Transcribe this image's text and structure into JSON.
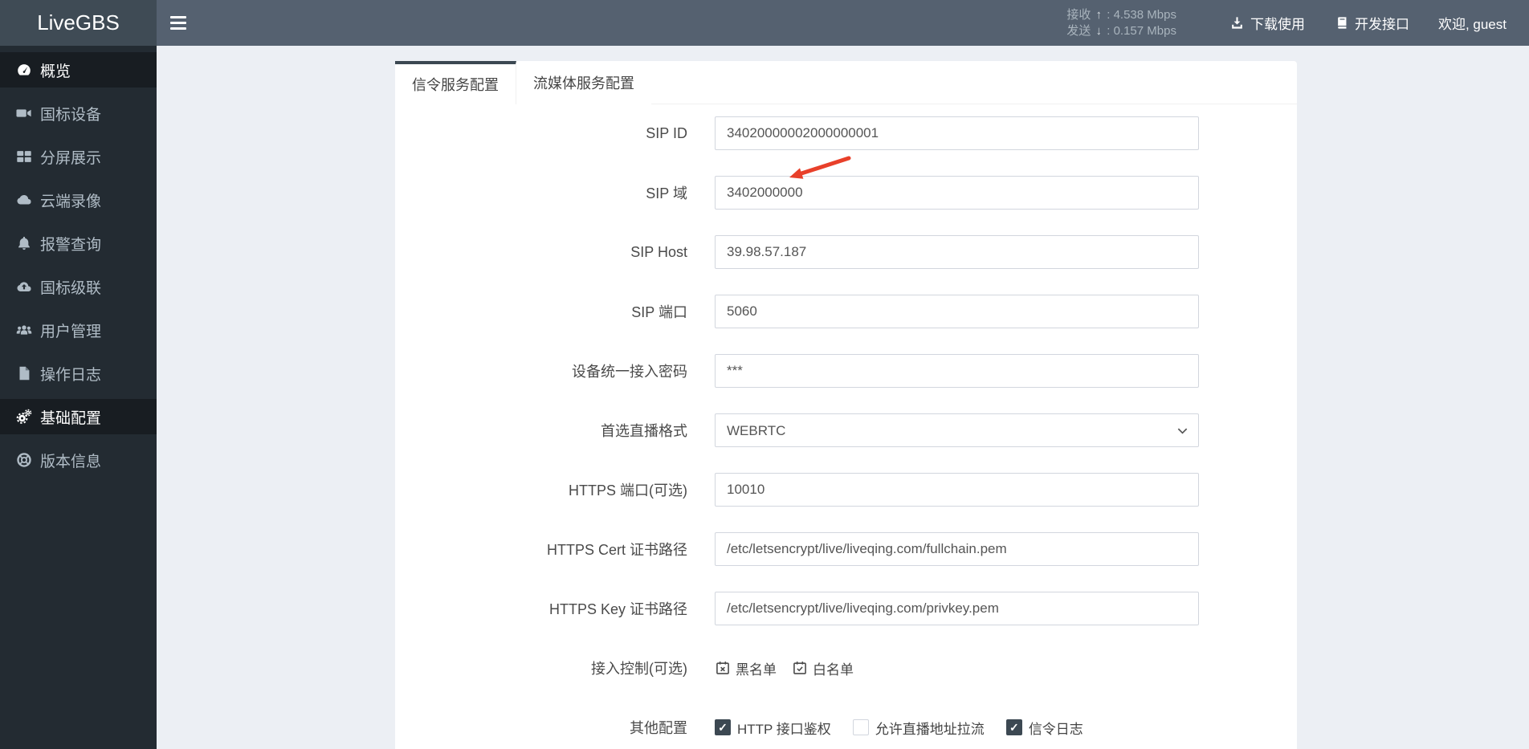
{
  "app": {
    "title": "LiveGBS"
  },
  "header": {
    "separator": ":",
    "stats": {
      "recv_label": "接收",
      "recv_value": "4.538 Mbps",
      "send_label": "发送",
      "send_value": "0.157 Mbps"
    },
    "download_label": "下载使用",
    "api_label": "开发接口",
    "welcome_label": "欢迎, guest"
  },
  "sidebar": {
    "items": [
      {
        "label": "概览",
        "icon": "dashboard-icon",
        "active": true
      },
      {
        "label": "国标设备",
        "icon": "camera-icon",
        "active": false
      },
      {
        "label": "分屏展示",
        "icon": "grid-icon",
        "active": false
      },
      {
        "label": "云端录像",
        "icon": "cloud-icon",
        "active": false
      },
      {
        "label": "报警查询",
        "icon": "bell-icon",
        "active": false
      },
      {
        "label": "国标级联",
        "icon": "cloud-upload-icon",
        "active": false
      },
      {
        "label": "用户管理",
        "icon": "users-icon",
        "active": false
      },
      {
        "label": "操作日志",
        "icon": "file-icon",
        "active": false
      },
      {
        "label": "基础配置",
        "icon": "gears-icon",
        "active": true
      },
      {
        "label": "版本信息",
        "icon": "version-icon",
        "active": false
      }
    ]
  },
  "tabs": [
    {
      "label": "信令服务配置",
      "active": true
    },
    {
      "label": "流媒体服务配置",
      "active": false
    }
  ],
  "form": {
    "fields": [
      {
        "label": "SIP ID",
        "value": "34020000002000000001",
        "type": "text"
      },
      {
        "label": "SIP 域",
        "value": "3402000000",
        "type": "text"
      },
      {
        "label": "SIP Host",
        "value": "39.98.57.187",
        "type": "text"
      },
      {
        "label": "SIP 端口",
        "value": "5060",
        "type": "text"
      },
      {
        "label": "设备统一接入密码",
        "value": "***",
        "type": "password"
      },
      {
        "label": "首选直播格式",
        "value": "WEBRTC",
        "type": "select"
      },
      {
        "label": "HTTPS 端口(可选)",
        "value": "10010",
        "type": "text"
      },
      {
        "label": "HTTPS Cert 证书路径",
        "value": "/etc/letsencrypt/live/liveqing.com/fullchain.pem",
        "type": "text"
      },
      {
        "label": "HTTPS Key 证书路径",
        "value": "/etc/letsencrypt/live/liveqing.com/privkey.pem",
        "type": "text"
      }
    ],
    "access_control": {
      "label": "接入控制(可选)",
      "items": [
        {
          "label": "黑名单",
          "icon": "calendar-times-icon"
        },
        {
          "label": "白名单",
          "icon": "calendar-check-icon"
        }
      ]
    },
    "other_config": {
      "label": "其他配置",
      "checkboxes": [
        {
          "label": "HTTP 接口鉴权",
          "checked": true
        },
        {
          "label": "允许直播地址拉流",
          "checked": false
        },
        {
          "label": "信令日志",
          "checked": true
        }
      ]
    }
  },
  "annotation": {
    "arrow_color": "#e8402a"
  },
  "colors": {
    "header_bg": "#556170",
    "logo_bg": "#3f4b55",
    "sidebar_bg": "#232b32",
    "sidebar_active_bg": "#181d22",
    "accent": "#3c4852",
    "page_bg": "#eceff4",
    "checkbox_checked": "#3c4852",
    "input_border": "#d2d6de"
  }
}
